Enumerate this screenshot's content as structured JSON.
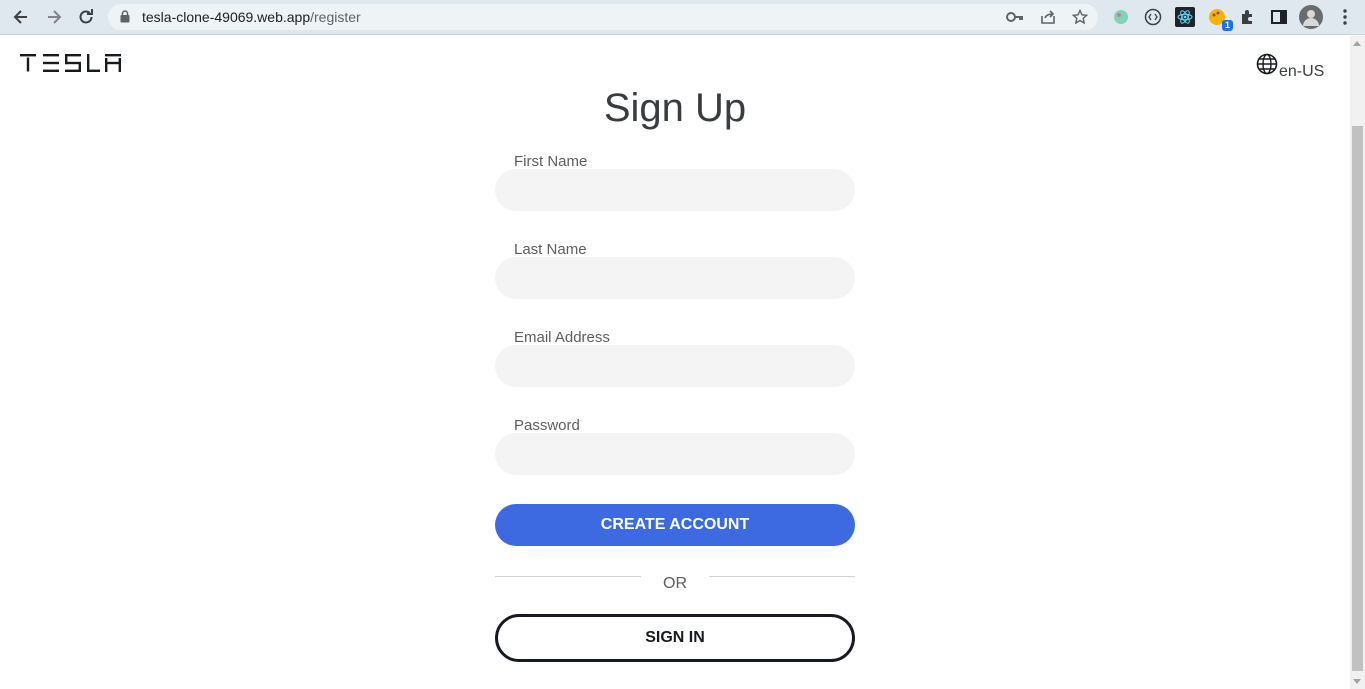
{
  "browser": {
    "url_host": "tesla-clone-49069.web.app",
    "url_path": "/register",
    "extension_badge": "1"
  },
  "header": {
    "logo_text": "TESLA",
    "language": "en-US"
  },
  "form": {
    "title": "Sign Up",
    "first_name_label": "First Name",
    "last_name_label": "Last Name",
    "email_label": "Email Address",
    "password_label": "Password",
    "first_name_value": "",
    "last_name_value": "",
    "email_value": "",
    "password_value": "",
    "create_account_label": "CREATE ACCOUNT",
    "or_label": "OR",
    "sign_in_label": "SIGN IN"
  },
  "colors": {
    "primary_button": "#3e6ae1",
    "input_background": "#f4f4f4",
    "text_dark": "#393c41"
  }
}
